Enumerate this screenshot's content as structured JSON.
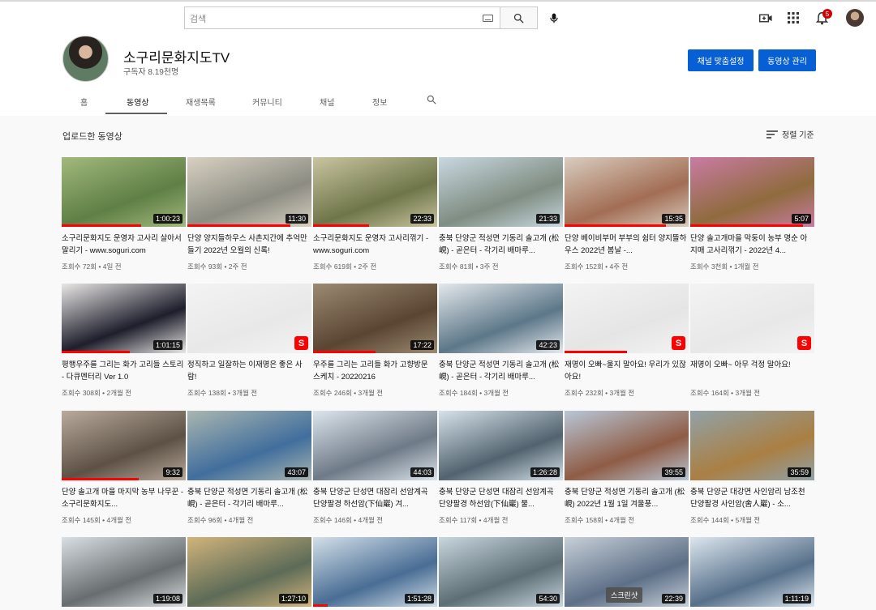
{
  "search": {
    "placeholder": "검색"
  },
  "notifications": {
    "count": "5"
  },
  "channel": {
    "name": "소구리문화지도TV",
    "subscribers": "구독자 8.19천명",
    "customize_label": "채널 맞춤설정",
    "manage_label": "동영상 관리"
  },
  "tabs": [
    {
      "label": "홈"
    },
    {
      "label": "동영상"
    },
    {
      "label": "재생목록"
    },
    {
      "label": "커뮤니티"
    },
    {
      "label": "채널"
    },
    {
      "label": "정보"
    }
  ],
  "section": {
    "title": "업로드한 동영상",
    "sort_label": "정렬 기준"
  },
  "tooltip": "스크린샷",
  "videos": [
    {
      "title": "소구리문화지도 운영자 고사리 살아서 말리기 - www.soguri.com",
      "meta": "조회수 72회 • 4일 전",
      "duration": "1:00:23",
      "colors": [
        "#5e7f46",
        "#a2b97c"
      ],
      "progress": 0.64
    },
    {
      "title": "단양 양지들하우스 사촌지간에 추억만들기 2022년 오월의 신록!",
      "meta": "조회수 93회 • 2주 전",
      "duration": "11:30",
      "colors": [
        "#8c8c83",
        "#d8d1c1"
      ],
      "progress": 0.83
    },
    {
      "title": "소구리문화지도 운영자 고사리꺾기 - www.soguri.com",
      "meta": "조회수 619회 • 2주 전",
      "duration": "22:33",
      "colors": [
        "#6e7649",
        "#c9c4a1"
      ],
      "progress": 0.45
    },
    {
      "title": "충북 단양군 적성면 기동리 솔고개 (松峴) - 곧은터 - 각기리 배마루...",
      "meta": "조회수 81회 • 3주 전",
      "duration": "21:33",
      "colors": [
        "#7f8d82",
        "#c9d8e0"
      ],
      "progress": 0
    },
    {
      "title": "단양 베이비부머 부부의 쉼터 양지뜰하우스 2022년 봄날 -...",
      "meta": "조회수 152회 • 4주 전",
      "duration": "15:35",
      "colors": [
        "#a26d54",
        "#d9cdbf"
      ],
      "progress": 0.82
    },
    {
      "title": "단양 솔고개마을 막둥이 농부 명순 아지매 고사리꺾기 - 2022년 4...",
      "meta": "조회수 3천회 • 1개월 전",
      "duration": "5:07",
      "colors": [
        "#8f6b3e",
        "#c97ba3"
      ],
      "progress": 0.91
    },
    {
      "title": "평행우주를 그리는 화가 고리들 스토리 - 다큐멘터리 Ver 1.0",
      "meta": "조회수 308회 • 2개월 전",
      "duration": "1:01:15",
      "colors": [
        "#1e1e2c",
        "#e9e7e5"
      ],
      "progress": 0.55
    },
    {
      "title": "정직하고 일잘하는 이재명은 좋은 사람!",
      "meta": "조회수 138회 • 3개월 전",
      "duration": "",
      "colors": [
        "#e8e8e8",
        "#f3f3f3"
      ],
      "progress": 0,
      "shorts": "S"
    },
    {
      "title": "우주를 그리는 고리들 화가 고향방문 스케치 - 20220216",
      "meta": "조회수 246회 • 3개월 전",
      "duration": "17:22",
      "colors": [
        "#5a4533",
        "#9b8a72"
      ],
      "progress": 0.5
    },
    {
      "title": "충북 단양군 적성면 기동리 솔고개 (松峴) - 곧은터 - 각기리 배마루...",
      "meta": "조회수 184회 • 3개월 전",
      "duration": "42:23",
      "colors": [
        "#5d7788",
        "#e4e8ec"
      ],
      "progress": 0
    },
    {
      "title": "재명이 오빠~울지 말아요! 우리가 있잖아요!",
      "meta": "조회수 232회 • 3개월 전",
      "duration": "",
      "colors": [
        "#e5e5e5",
        "#f3f3f3"
      ],
      "progress": 0.5,
      "shorts": "S"
    },
    {
      "title": "재명이 오빠~ 아무 걱정 말아요!",
      "meta": "조회수 164회 • 3개월 전",
      "duration": "",
      "colors": [
        "#e8e8e8",
        "#f3f3f3"
      ],
      "progress": 0,
      "shorts": "S"
    },
    {
      "title": "단양 솔고개 마을 마지막 농부 나무꾼 - 소구리문화지도...",
      "meta": "조회수 145회 • 4개월 전",
      "duration": "9:32",
      "colors": [
        "#5d5146",
        "#b8ab9c"
      ],
      "progress": 0.62
    },
    {
      "title": "충북 단양군 적성면 기동리 솔고개 (松峴) - 곧은터 - 각기리 배마루...",
      "meta": "조회수 96회 • 4개월 전",
      "duration": "43:07",
      "colors": [
        "#416e9d",
        "#a9b6b0"
      ],
      "progress": 0
    },
    {
      "title": "충북 단양군 단성면 대잠리 선암계곡 단양팔경 하선암(下仙巖) 겨...",
      "meta": "조회수 146회 • 4개월 전",
      "duration": "44:03",
      "colors": [
        "#6e7a87",
        "#dde5ec"
      ],
      "progress": 0
    },
    {
      "title": "충북 단양군 단성면 대잠리 선암계곡 단양팔경 하선암(下仙巖) 물...",
      "meta": "조회수 117회 • 4개월 전",
      "duration": "1:26:28",
      "colors": [
        "#52636f",
        "#d6e2ea"
      ],
      "progress": 0
    },
    {
      "title": "충북 단양군 적성면 기동리 솔고개 (松峴) 2022년 1월 1일 겨울풍...",
      "meta": "조회수 158회 • 4개월 전",
      "duration": "39:55",
      "colors": [
        "#8f5c45",
        "#b8c7d7"
      ],
      "progress": 0
    },
    {
      "title": "충북 단양군 대강면 사인암리 남조천 단양팔경 사인암(舍人巖) - 소...",
      "meta": "조회수 144회 • 5개월 전",
      "duration": "35:59",
      "colors": [
        "#aa7f43",
        "#91a2a8"
      ],
      "progress": 0
    },
    {
      "title": "",
      "meta": "",
      "duration": "1:19:08",
      "colors": [
        "#686d6f",
        "#d9dfe3"
      ],
      "progress": 0
    },
    {
      "title": "",
      "meta": "",
      "duration": "1:27:10",
      "colors": [
        "#5d6b57",
        "#d1b47c"
      ],
      "progress": 0
    },
    {
      "title": "",
      "meta": "",
      "duration": "1:51:28",
      "colors": [
        "#496d94",
        "#d3dfe8"
      ],
      "progress": 0.12
    },
    {
      "title": "",
      "meta": "",
      "duration": "54:30",
      "colors": [
        "#5d6e75",
        "#c8d6de"
      ],
      "progress": 0
    },
    {
      "title": "",
      "meta": "",
      "duration": "22:39",
      "colors": [
        "#5d6f87",
        "#c7d0d8"
      ],
      "progress": 0
    },
    {
      "title": "",
      "meta": "",
      "duration": "1:11:19",
      "colors": [
        "#57708a",
        "#dce6ee"
      ],
      "progress": 0
    }
  ]
}
